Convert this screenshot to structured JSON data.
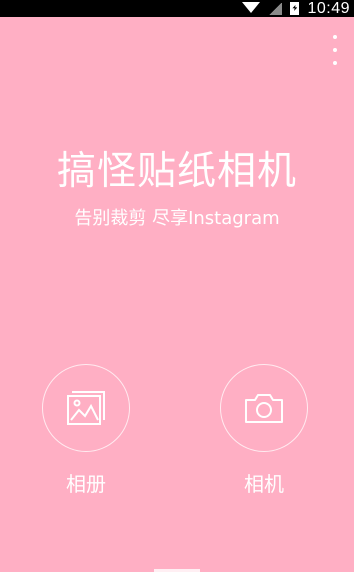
{
  "status_bar": {
    "time": "10:49",
    "icons": [
      "wifi-icon",
      "signal-icon",
      "battery-icon"
    ]
  },
  "toolbar": {
    "menu_icon": "overflow-menu-icon"
  },
  "header": {
    "title": "搞怪贴纸相机",
    "subtitle": "告别裁剪 尽享Instagram"
  },
  "actions": [
    {
      "label": "相册",
      "icon": "gallery-icon"
    },
    {
      "label": "相机",
      "icon": "camera-icon"
    }
  ],
  "colors": {
    "background": "#FFAFC4",
    "text": "#FFFFFF"
  }
}
